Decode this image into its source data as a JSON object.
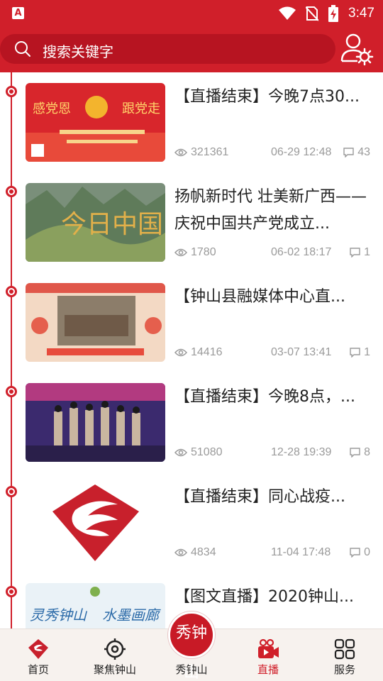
{
  "status_bar": {
    "app_badge": "A",
    "time": "3:47",
    "icons": [
      "wifi-icon",
      "no-sim-icon",
      "battery-charging-icon"
    ]
  },
  "search": {
    "placeholder": "搜索关键字",
    "icon": "search-icon"
  },
  "header": {
    "user_icon": "user-settings-icon",
    "accent_color": "#d01f2a"
  },
  "feed": [
    {
      "title": "【直播结束】今晚7点30...",
      "views": "321361",
      "date": "06-29 12:48",
      "comments": "43"
    },
    {
      "title": "扬帆新时代 壮美新广西——庆祝中国共产党成立...",
      "views": "1780",
      "date": "06-02 18:17",
      "comments": "1"
    },
    {
      "title": "【钟山县融媒体中心直...",
      "views": "14416",
      "date": "03-07 13:41",
      "comments": "1"
    },
    {
      "title": "【直播结束】今晚8点，...",
      "views": "51080",
      "date": "12-28 19:39",
      "comments": "8"
    },
    {
      "title": "【直播结束】同心战疫...",
      "views": "4834",
      "date": "11-04 17:48",
      "comments": "0"
    },
    {
      "title": "【图文直播】2020钟山...",
      "views": "",
      "date": "",
      "comments": ""
    }
  ],
  "bottom_nav": {
    "items": [
      {
        "label": "首页",
        "icon": "home-logo-icon"
      },
      {
        "label": "聚焦钟山",
        "icon": "target-icon"
      },
      {
        "label": "秀钟山",
        "icon": "xiu-zhongshan-logo-icon"
      },
      {
        "label": "直播",
        "icon": "live-camera-icon",
        "active": true
      },
      {
        "label": "服务",
        "icon": "grid-icon"
      }
    ],
    "center_logo_text": "秀钟山"
  }
}
